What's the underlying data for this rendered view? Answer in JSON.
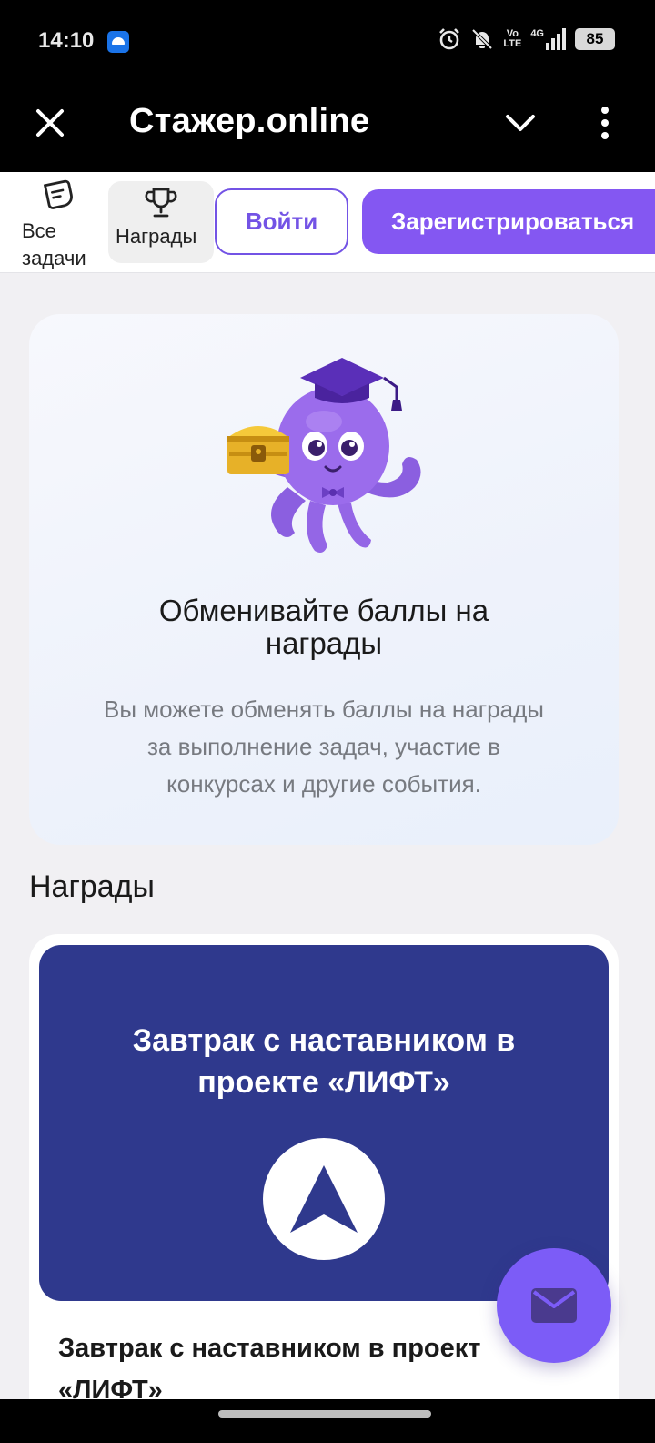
{
  "status_bar": {
    "time": "14:10",
    "volte_top": "Vo",
    "volte_bottom": "LTE",
    "network": "4G",
    "battery": "85"
  },
  "header": {
    "title": "Стажер.online"
  },
  "nav": {
    "all_tasks_line1": "Все",
    "all_tasks_line2": "задачи",
    "rewards": "Награды",
    "login": "Войти",
    "register": "Зарегистрироваться"
  },
  "promo": {
    "title_line1": "Обменивайте баллы на",
    "title_line2": "награды",
    "text_line1": "Вы можете обменять баллы на награды",
    "text_line2": "за выполнение задач, участие в",
    "text_line3": "конкурсах и другие события."
  },
  "rewards": {
    "section_title": "Награды",
    "items": [
      {
        "image_line1": "Завтрак с наставником в",
        "image_line2": "проекте «ЛИФТ»",
        "name_line1": "Завтрак с наставником в проект",
        "name_line2": "«ЛИФТ»"
      }
    ]
  },
  "colors": {
    "accent": "#8457f2",
    "accent_border": "#7353e5",
    "reward_bg": "#2f398d",
    "fab": "#7c5cf7"
  },
  "icons": [
    "alarm-icon",
    "mute-icon",
    "signal-icon",
    "close-icon",
    "chevron-down-icon",
    "more-vert-icon",
    "tasks-icon",
    "trophy-icon",
    "mail-icon",
    "arrow-up-icon"
  ]
}
